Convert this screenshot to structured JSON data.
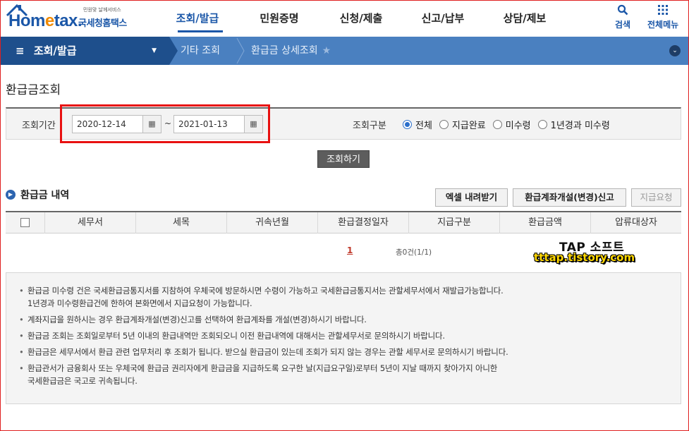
{
  "header": {
    "logo_text_a": "Hom",
    "logo_text_b": "e",
    "logo_text_c": "tax.",
    "logo_sub": "민원맞 날께서비스",
    "logo_name": "국세청홈택스",
    "menu": [
      "조회/발급",
      "민원증명",
      "신청/제출",
      "신고/납부",
      "상담/제보"
    ],
    "search_label": "검색",
    "all_menu_label": "전체메뉴"
  },
  "navbar": {
    "main_label": "조회/발급",
    "crumb1": "기타 조회",
    "crumb2": "환급금 상세조회"
  },
  "page": {
    "title": "환급금조회"
  },
  "search": {
    "period_label": "조회기간",
    "start_date": "2020-12-14",
    "end_date": "2021-01-13",
    "tilde": "~",
    "type_label": "조회구분",
    "options": [
      "전체",
      "지급완료",
      "미수령",
      "1년경과 미수령"
    ],
    "selected_option": "전체",
    "button": "조회하기"
  },
  "section": {
    "title": "환급금 내역",
    "btn_excel": "엑셀 내려받기",
    "btn_account": "환급계좌개설(변경)신고",
    "btn_request": "지급요청"
  },
  "table": {
    "columns": [
      "세무서",
      "세목",
      "귀속년월",
      "환급결정일자",
      "지급구분",
      "환급금액",
      "압류대상자"
    ]
  },
  "pagination": {
    "page": "1",
    "count": "총0건(1/1)"
  },
  "watermark": {
    "line1": "TAP 소프트",
    "line2": "tttap.tistory.com"
  },
  "notices": [
    "환급금 미수령 건은 국세환급금통지서를 지참하여 우체국에 방문하시면 수령이 가능하고 국세환급금통지서는 관할세무서에서 재발급가능합니다.",
    "1년경과 미수령환급건에 한하여 본화면에서 지급요청이 가능합니다.",
    "계좌지급을 원하시는 경우 환급계좌개설(변경)신고를 선택하여 환급계좌를 개설(변경)하시기 바랍니다.",
    "환급금 조회는 조회일로부터 5년 이내의 환급내역만 조회되오니 이전 환급내역에 대해서는 관할세무서로 문의하시기 바랍니다.",
    "환급금은 세무서에서 환급 관련 업무처리 후 조회가 됩니다. 받으실 환급금이 있는데 조회가 되지 않는 경우는 관할 세무서로 문의하시기 바랍니다.",
    "환급관서가 금융회사 또는 우체국에 환급금 권리자에게 환급금을 지급하도록 요구한 날(지급요구일)로부터 5년이 지날 때까지 찾아가지 아니한",
    "국세환급금은 국고로 귀속됩니다."
  ],
  "colors": {
    "brand": "#1b57a8",
    "nav_dark": "#1e4f8c",
    "nav_light": "#4a80c0",
    "highlight": "#e81010"
  }
}
